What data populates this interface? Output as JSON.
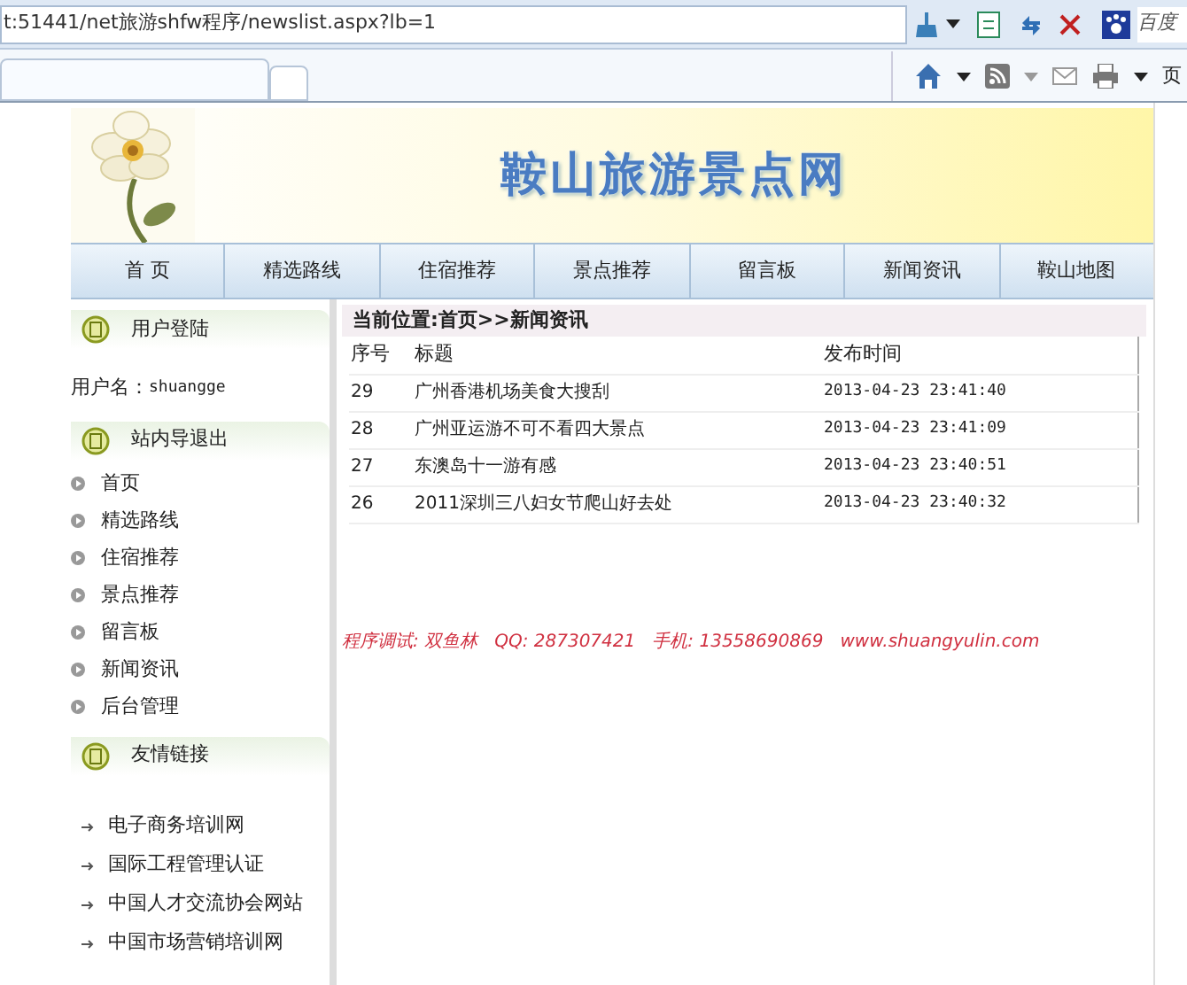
{
  "browser": {
    "address": "t:51441/net旅游shfw程序/newslist.aspx?lb=1",
    "search_placeholder": "百度",
    "page_menu": "页"
  },
  "site": {
    "title": "鞍山旅游景点网",
    "nav": [
      "首 页",
      "精选路线",
      "住宿推荐",
      "景点推荐",
      "留言板",
      "新闻资讯",
      "鞍山地图"
    ]
  },
  "sidebar": {
    "login_title": "用户登陆",
    "username_label": "用户名：",
    "username": "shuangge",
    "guide_title": "站内导",
    "logout": "退出",
    "guide_items": [
      "首页",
      "精选路线",
      "住宿推荐",
      "景点推荐",
      "留言板",
      "新闻资讯",
      "后台管理"
    ],
    "links_title": "友情链接",
    "links": [
      "电子商务培训网",
      "国际工程管理认证",
      "中国人才交流协会网站",
      "中国市场营销培训网"
    ]
  },
  "breadcrumb": "当前位置:首页>>新闻资讯",
  "table": {
    "columns": [
      "序号",
      "标题",
      "发布时间"
    ],
    "rows": [
      [
        "29",
        "广州香港机场美食大搜刮",
        "2013-04-23 23:41:40"
      ],
      [
        "28",
        "广州亚运游不可不看四大景点",
        "2013-04-23 23:41:09"
      ],
      [
        "27",
        "东澳岛十一游有感",
        "2013-04-23 23:40:51"
      ],
      [
        "26",
        "2011深圳三八妇女节爬山好去处",
        "2013-04-23 23:40:32"
      ]
    ]
  },
  "credit": "程序调试: 双鱼林   QQ: 287307421   手机: 13558690869   www.shuangyulin.com"
}
